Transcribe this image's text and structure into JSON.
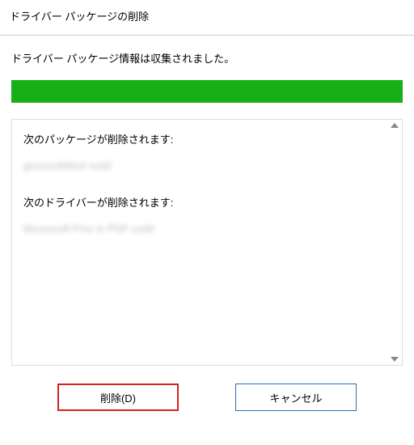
{
  "window": {
    "title": "ドライバー パッケージの削除"
  },
  "status": {
    "message": "ドライバー パッケージ情報は収集されました。"
  },
  "progress": {
    "percent": 100,
    "color": "#16b016"
  },
  "panel": {
    "packages_heading": "次のパッケージが削除されます:",
    "package_item": "gxxxxxdddxxl xxdd",
    "drivers_heading": "次のドライバーが削除されます:",
    "driver_item": "Mxxxxxxft Prxx tx PDF xxdd"
  },
  "buttons": {
    "delete_label": "削除(D)",
    "cancel_label": "キャンセル"
  }
}
